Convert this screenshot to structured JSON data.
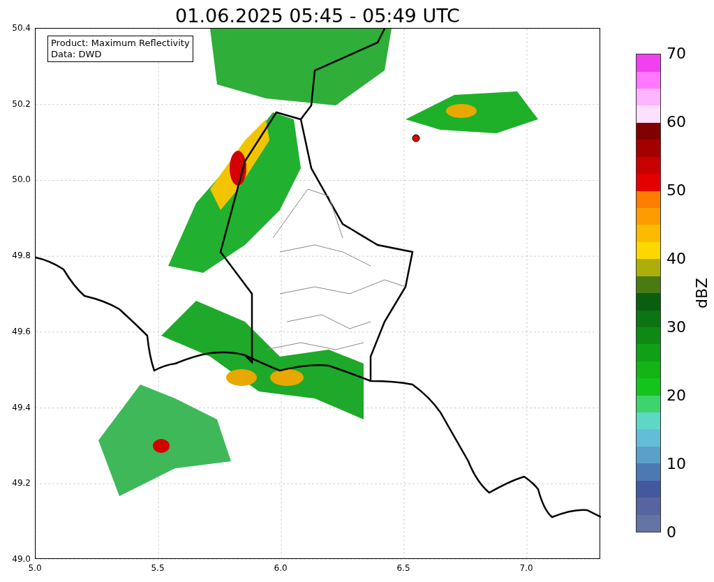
{
  "title": "01.06.2025 05:45 - 05:49 UTC",
  "map": {
    "legend_lines": [
      "Product: Maximum Reflectivity",
      "Data: DWD"
    ],
    "x_ticks": [
      "5.0",
      "5.5",
      "6.0",
      "6.5",
      "7.0"
    ],
    "y_ticks": [
      "50.4",
      "50.2",
      "50.0",
      "49.8",
      "49.6",
      "49.4",
      "49.2",
      "49.0"
    ]
  },
  "colorbar": {
    "label": "dBZ",
    "ticks": [
      "70",
      "60",
      "50",
      "40",
      "30",
      "20",
      "10",
      "0"
    ],
    "segments": [
      {
        "color": "#6474a5"
      },
      {
        "color": "#56659f"
      },
      {
        "color": "#4458a0"
      },
      {
        "color": "#4d79b3"
      },
      {
        "color": "#5aa0c8"
      },
      {
        "color": "#62bed8"
      },
      {
        "color": "#5fd7c5"
      },
      {
        "color": "#3dd46e"
      },
      {
        "color": "#13c41c"
      },
      {
        "color": "#12b416"
      },
      {
        "color": "#10a016"
      },
      {
        "color": "#0e8a14"
      },
      {
        "color": "#0c7412"
      },
      {
        "color": "#0a5e10"
      },
      {
        "color": "#4a7a12"
      },
      {
        "color": "#acaf0b"
      },
      {
        "color": "#fdd800"
      },
      {
        "color": "#fcbb00"
      },
      {
        "color": "#fd9c00"
      },
      {
        "color": "#fd7e00"
      },
      {
        "color": "#e40000"
      },
      {
        "color": "#c80000"
      },
      {
        "color": "#a50000"
      },
      {
        "color": "#800000"
      },
      {
        "color": "#ffe0ff"
      },
      {
        "color": "#ffb4ff"
      },
      {
        "color": "#ff78ff"
      },
      {
        "color": "#f040f0"
      }
    ]
  }
}
